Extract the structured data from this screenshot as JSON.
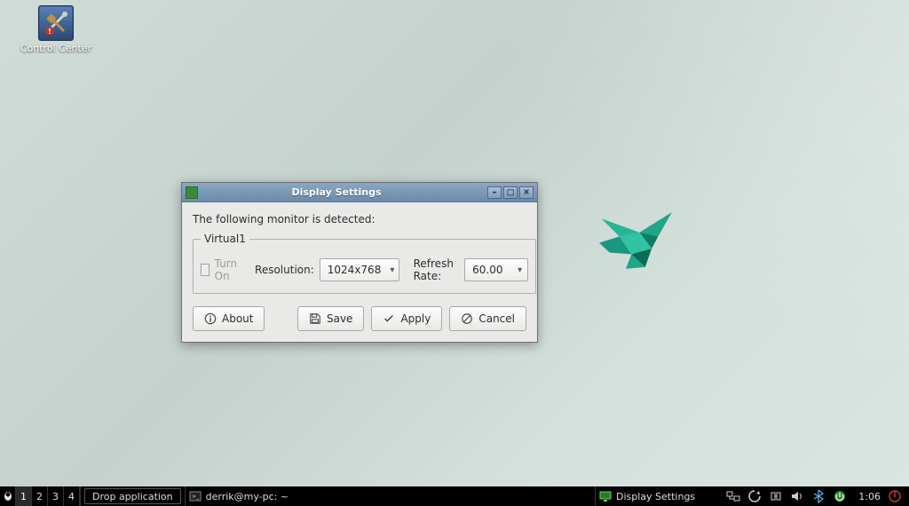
{
  "desktop": {
    "icons": {
      "control_center": "Control Center"
    }
  },
  "window": {
    "title": "Display Settings",
    "detect_text": "The following monitor is detected:",
    "monitor_name": "Virtual1",
    "turn_on_label": "Turn On",
    "resolution_label": "Resolution:",
    "resolution_value": "1024x768",
    "refresh_label": "Refresh Rate:",
    "refresh_value": "60.00",
    "buttons": {
      "about": "About",
      "save": "Save",
      "apply": "Apply",
      "cancel": "Cancel"
    }
  },
  "taskbar": {
    "pager": [
      "1",
      "2",
      "3",
      "4"
    ],
    "drop_app": "Drop application",
    "tasks": {
      "terminal": "derrik@my-pc: ~",
      "display": "Display Settings"
    },
    "clock": "1:06"
  }
}
